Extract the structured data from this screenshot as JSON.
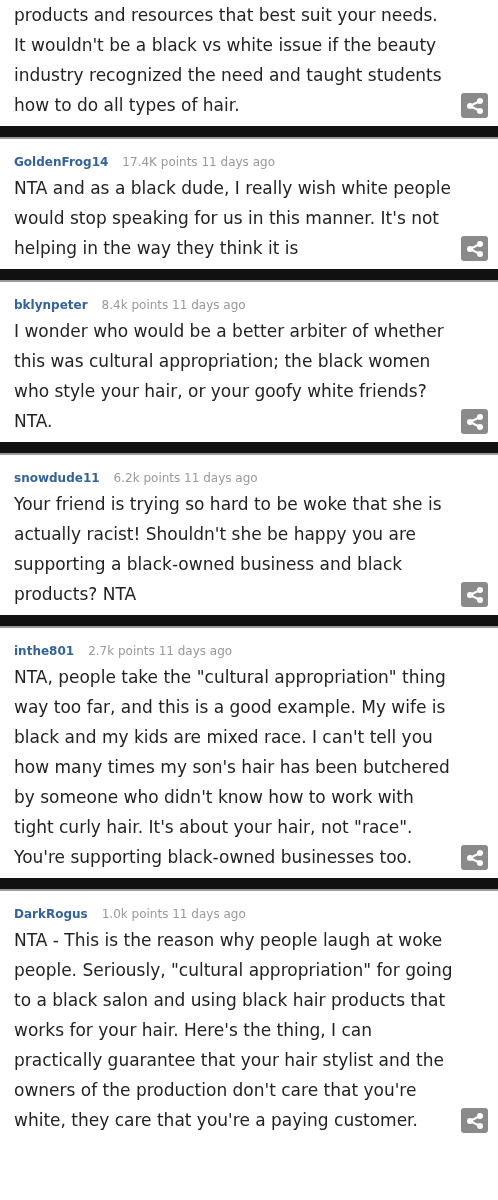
{
  "comments": [
    {
      "text": "products and resources that best suit your needs. It wouldn't be a black vs white issue if the beauty industry recognized the need and taught students how to do all types of hair."
    },
    {
      "author": "GoldenFrog14",
      "meta": "17.4K points 11 days ago",
      "text": "NTA and as a black dude, I really wish white people would stop speaking for us in this manner. It's not helping in the way they think it is"
    },
    {
      "author": "bklynpeter",
      "meta": "8.4k points 11 days ago",
      "text": "I wonder who would be a better arbiter of whether this was cultural appropriation; the black women who style your hair, or your goofy white friends? NTA."
    },
    {
      "author": "snowdude11",
      "meta": "6.2k points 11 days ago",
      "text": "Your friend is trying so hard to be woke that she is actually racist! Shouldn't she be happy you are supporting a black-owned business and black products? NTA"
    },
    {
      "author": "inthe801",
      "meta": "2.7k points 11 days ago",
      "text": "NTA, people take the \"cultural appropriation\" thing way too far, and this is a good example. My wife is black and my kids are mixed race. I can't tell you how many times my son's hair has been butchered by someone who didn't know how to work with tight curly hair. It's about your hair, not \"race\". You're supporting black-owned businesses too."
    },
    {
      "author": "DarkRogus",
      "meta": "1.0k points 11 days ago",
      "text": "NTA - This is the reason why people laugh at woke people. Seriously, \"cultural appropriation\" for going to a black salon and using black hair products that works for your hair. Here's the thing, I can practically guarantee that your hair stylist and the owners of the production don't care that you're white, they care that you're a paying customer."
    }
  ]
}
